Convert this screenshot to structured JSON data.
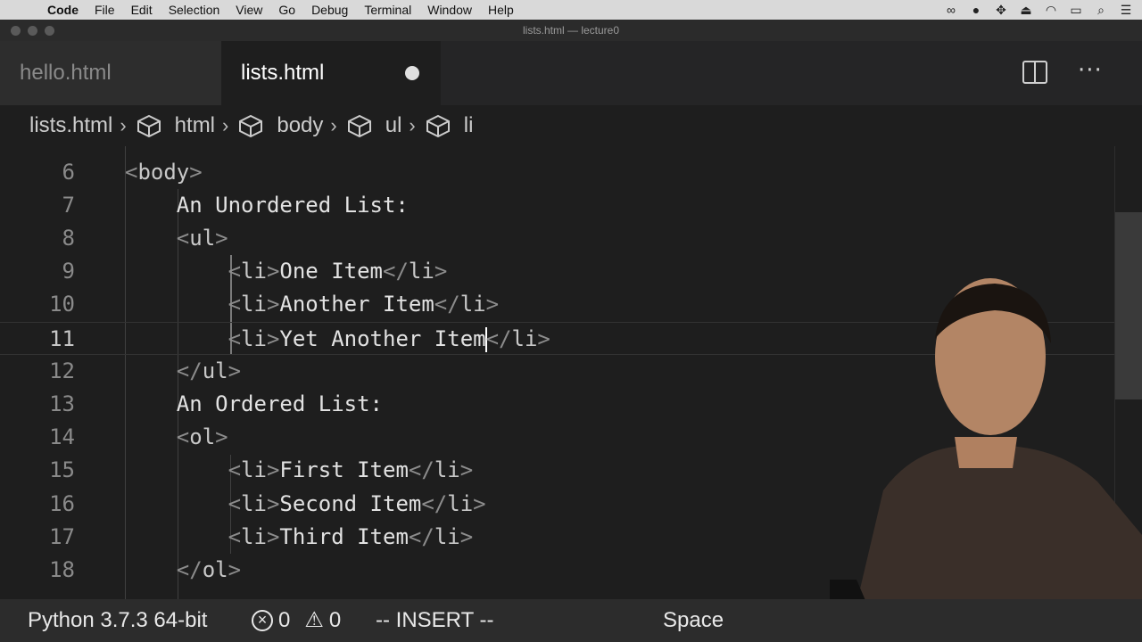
{
  "menubar": {
    "apple_icon": "apple-icon",
    "items": [
      "Code",
      "File",
      "Edit",
      "Selection",
      "View",
      "Go",
      "Debug",
      "Terminal",
      "Window",
      "Help"
    ],
    "tray_icons": [
      "glasses-icon",
      "record-icon",
      "move-icon",
      "eject-icon",
      "wifi-icon",
      "battery-icon",
      "search-icon",
      "list-icon"
    ]
  },
  "window": {
    "title": "lists.html — lecture0"
  },
  "tabs": [
    {
      "label": "hello.html",
      "active": false,
      "dirty": false
    },
    {
      "label": "lists.html",
      "active": true,
      "dirty": true
    }
  ],
  "breadcrumbs": [
    "lists.html",
    "html",
    "body",
    "ul",
    "li"
  ],
  "editor": {
    "cursor_line": 11,
    "lines": [
      {
        "n": "6",
        "parts": [
          [
            "p",
            "<"
          ],
          [
            "t",
            "body"
          ],
          [
            "p",
            ">"
          ]
        ]
      },
      {
        "n": "7",
        "parts": [
          [
            "x",
            "An Unordered List:"
          ]
        ]
      },
      {
        "n": "8",
        "parts": [
          [
            "p",
            "<"
          ],
          [
            "t",
            "ul"
          ],
          [
            "p",
            ">"
          ]
        ]
      },
      {
        "n": "9",
        "parts": [
          [
            "p",
            "<"
          ],
          [
            "t",
            "li"
          ],
          [
            "p",
            ">"
          ],
          [
            "x",
            "One Item"
          ],
          [
            "p",
            "</"
          ],
          [
            "t",
            "li"
          ],
          [
            "p",
            ">"
          ]
        ]
      },
      {
        "n": "10",
        "parts": [
          [
            "p",
            "<"
          ],
          [
            "t",
            "li"
          ],
          [
            "p",
            ">"
          ],
          [
            "x",
            "Another Item"
          ],
          [
            "p",
            "</"
          ],
          [
            "t",
            "li"
          ],
          [
            "p",
            ">"
          ]
        ]
      },
      {
        "n": "11",
        "parts": [
          [
            "p",
            "<"
          ],
          [
            "t",
            "li"
          ],
          [
            "p",
            ">"
          ],
          [
            "x",
            "Yet Another Item"
          ],
          [
            "c",
            ""
          ],
          [
            "p",
            "</"
          ],
          [
            "t",
            "li"
          ],
          [
            "p",
            ">"
          ]
        ]
      },
      {
        "n": "12",
        "parts": [
          [
            "p",
            "</"
          ],
          [
            "t",
            "ul"
          ],
          [
            "p",
            ">"
          ]
        ]
      },
      {
        "n": "13",
        "parts": [
          [
            "x",
            "An Ordered List:"
          ]
        ]
      },
      {
        "n": "14",
        "parts": [
          [
            "p",
            "<"
          ],
          [
            "t",
            "ol"
          ],
          [
            "p",
            ">"
          ]
        ]
      },
      {
        "n": "15",
        "parts": [
          [
            "p",
            "<"
          ],
          [
            "t",
            "li"
          ],
          [
            "p",
            ">"
          ],
          [
            "x",
            "First Item"
          ],
          [
            "p",
            "</"
          ],
          [
            "t",
            "li"
          ],
          [
            "p",
            ">"
          ]
        ]
      },
      {
        "n": "16",
        "parts": [
          [
            "p",
            "<"
          ],
          [
            "t",
            "li"
          ],
          [
            "p",
            ">"
          ],
          [
            "x",
            "Second Item"
          ],
          [
            "p",
            "</"
          ],
          [
            "t",
            "li"
          ],
          [
            "p",
            ">"
          ]
        ]
      },
      {
        "n": "17",
        "parts": [
          [
            "p",
            "<"
          ],
          [
            "t",
            "li"
          ],
          [
            "p",
            ">"
          ],
          [
            "x",
            "Third Item"
          ],
          [
            "p",
            "</"
          ],
          [
            "t",
            "li"
          ],
          [
            "p",
            ">"
          ]
        ]
      },
      {
        "n": "18",
        "parts": [
          [
            "p",
            "</"
          ],
          [
            "t",
            "ol"
          ],
          [
            "p",
            ">"
          ]
        ]
      }
    ]
  },
  "statusbar": {
    "interpreter": "Python 3.7.3 64-bit",
    "errors": "0",
    "warnings": "0",
    "mode": "-- INSERT --",
    "indent": "Space"
  },
  "colors": {
    "editor_bg": "#1e1e1e",
    "tab_bar_bg": "#252526",
    "status_bg": "#2c2c2c"
  }
}
